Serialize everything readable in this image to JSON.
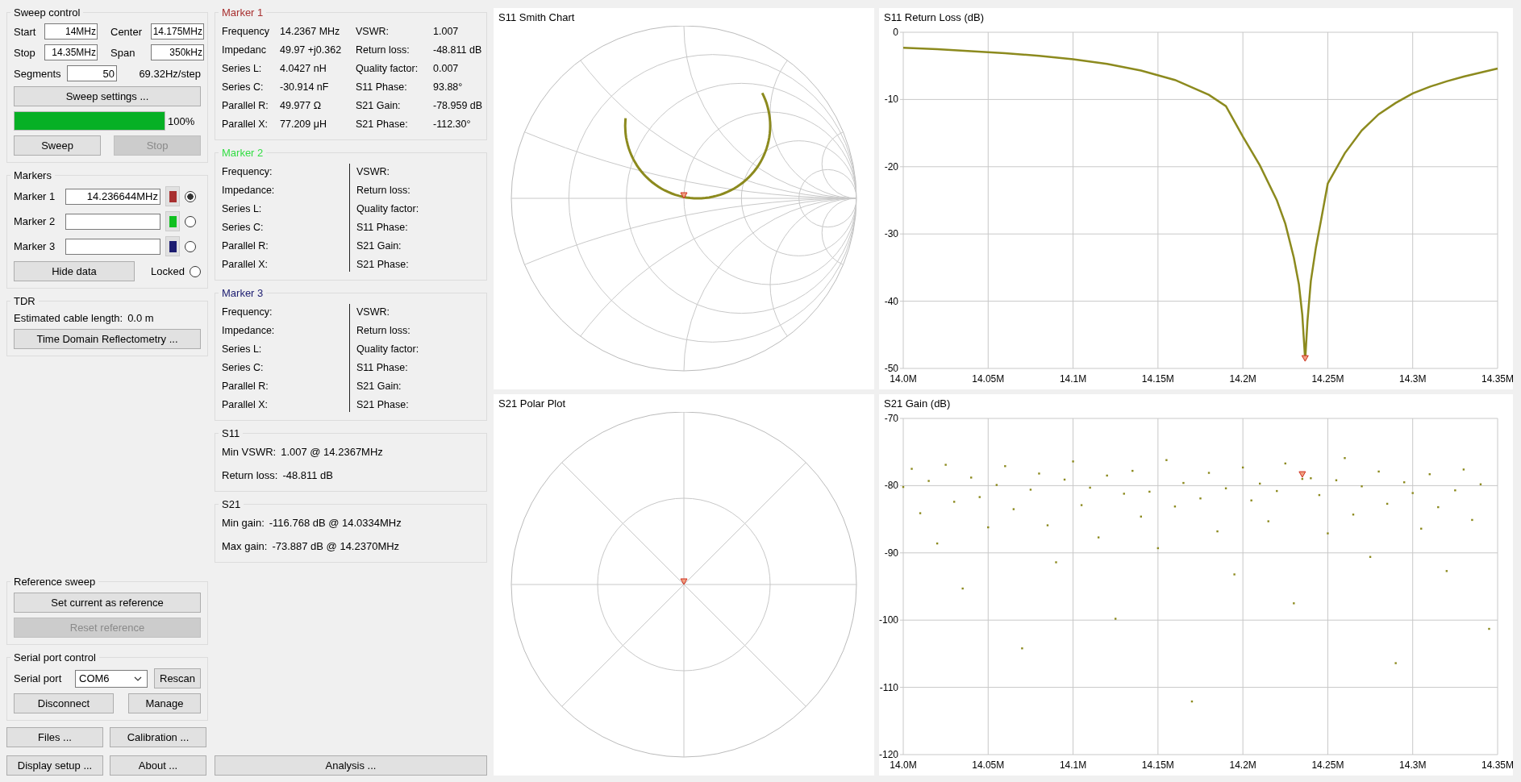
{
  "sweep_control": {
    "title": "Sweep control",
    "fields": [
      {
        "label": "Start",
        "value": "14MHz"
      },
      {
        "label": "Stop",
        "value": "14.35MHz"
      },
      {
        "label": "Center",
        "value": "14.175MHz"
      },
      {
        "label": "Span",
        "value": "350kHz"
      }
    ],
    "segments": {
      "label": "Segments",
      "value": "50"
    },
    "step": "69.32Hz/step",
    "settings_button": "Sweep settings ...",
    "progress": {
      "level": 1,
      "reading": "100%"
    },
    "buttons": [
      {
        "label": "Sweep",
        "disabled": false
      },
      {
        "label": "Stop",
        "disabled": true
      }
    ]
  },
  "markers": {
    "title": "Markers",
    "items": [
      {
        "label": "Marker 1",
        "value": "14.236644MHz",
        "color": "#a83030",
        "selected": true
      },
      {
        "label": "Marker 2",
        "color": "#10c020",
        "selected": false
      },
      {
        "label": "Marker 3",
        "color": "#1c1c70",
        "selected": false
      }
    ],
    "hide_button": "Hide data",
    "locked": {
      "label": "Locked",
      "checked": false
    }
  },
  "tdr": {
    "title": "TDR",
    "length_label": "Estimated cable length:",
    "length": "0.0 m",
    "button": "Time Domain Reflectometry ..."
  },
  "reference_sweep": {
    "title": "Reference sweep",
    "buttons": [
      {
        "label": "Set current as reference",
        "disabled": false
      },
      {
        "label": "Reset reference",
        "disabled": true
      }
    ]
  },
  "serial_port": {
    "title": "Serial port control",
    "label": "Serial port",
    "port": "COM6",
    "rescan": "Rescan",
    "buttons": [
      "Disconnect",
      "Manage"
    ]
  },
  "bottom_buttons": [
    "Files ...",
    "Calibration ...",
    "Display setup ...",
    "About ..."
  ],
  "analysis_button": "Analysis ...",
  "marker_panels": [
    {
      "title": "Marker 1",
      "color": "#a83030",
      "left": [
        {
          "label": "Frequency",
          "value": "14.2367 MHz"
        },
        {
          "label": "Impedanc",
          "value": "49.97 +j0.362"
        },
        {
          "label": "Series L:",
          "value": "4.0427 nH"
        },
        {
          "label": "Series C:",
          "value": "-30.914 nF"
        },
        {
          "label": "Parallel R:",
          "value": "49.977 Ω"
        },
        {
          "label": "Parallel X:",
          "value": "77.209 μH"
        }
      ],
      "right": [
        {
          "label": "VSWR:",
          "value": "1.007"
        },
        {
          "label": "Return loss:",
          "value": "-48.811 dB"
        },
        {
          "label": "Quality factor:",
          "value": "0.007"
        },
        {
          "label": "S11 Phase:",
          "value": "93.88°"
        },
        {
          "label": "S21 Gain:",
          "value": "-78.959 dB"
        },
        {
          "label": "S21 Phase:",
          "value": "-112.30°"
        }
      ]
    },
    {
      "title": "Marker 2",
      "color": "#33dd44",
      "left": [
        {
          "label": "Frequency:"
        },
        {
          "label": "Impedance:"
        },
        {
          "label": "Series L:"
        },
        {
          "label": "Series C:"
        },
        {
          "label": "Parallel R:"
        },
        {
          "label": "Parallel X:"
        }
      ],
      "right": [
        {
          "label": "VSWR:"
        },
        {
          "label": "Return loss:"
        },
        {
          "label": "Quality factor:"
        },
        {
          "label": "S11 Phase:"
        },
        {
          "label": "S21 Gain:"
        },
        {
          "label": "S21 Phase:"
        }
      ]
    },
    {
      "title": "Marker 3",
      "color": "#1c1c70",
      "left": [
        {
          "label": "Frequency:"
        },
        {
          "label": "Impedance:"
        },
        {
          "label": "Series L:"
        },
        {
          "label": "Series C:"
        },
        {
          "label": "Parallel R:"
        },
        {
          "label": "Parallel X:"
        }
      ],
      "right": [
        {
          "label": "VSWR:"
        },
        {
          "label": "Return loss:"
        },
        {
          "label": "Quality factor:"
        },
        {
          "label": "S11 Phase:"
        },
        {
          "label": "S21 Gain:"
        },
        {
          "label": "S21 Phase:"
        }
      ]
    }
  ],
  "summaries": [
    {
      "title": "S11",
      "rows": [
        {
          "label": "Min VSWR:",
          "value": "1.007 @ 14.2367MHz"
        },
        {
          "label": "Return loss:",
          "value": "-48.811 dB"
        }
      ]
    },
    {
      "title": "S21",
      "rows": [
        {
          "label": "Min gain:",
          "value": "-116.768 dB @ 14.0334MHz"
        },
        {
          "label": "Max gain:",
          "value": "-73.887 dB @ 14.2370MHz"
        }
      ]
    }
  ],
  "charts": [
    {
      "title": "S11 Smith Chart",
      "kind": "smith"
    },
    {
      "title": "S11 Return Loss (dB)",
      "kind": "plot",
      "chart_data": {
        "type": "line",
        "x": [
          14.0,
          14.02,
          14.04,
          14.06,
          14.08,
          14.1,
          14.12,
          14.14,
          14.16,
          14.18,
          14.19,
          14.2,
          14.21,
          14.22,
          14.225,
          14.23,
          14.233,
          14.235,
          14.2367,
          14.238,
          14.24,
          14.243,
          14.246,
          14.25,
          14.26,
          14.27,
          14.28,
          14.29,
          14.3,
          14.31,
          14.32,
          14.33,
          14.34,
          14.35
        ],
        "series": [
          {
            "color": "#8c8a1e",
            "values": [
              -2.3,
              -2.5,
              -2.8,
              -3.1,
              -3.5,
              -4.0,
              -4.7,
              -5.7,
              -7.1,
              -9.3,
              -11.0,
              -15.5,
              -19.8,
              -25.0,
              -28.5,
              -33.5,
              -37.5,
              -42.0,
              -48.8,
              -43.0,
              -37.0,
              -32.0,
              -28.0,
              -22.5,
              -18.0,
              -14.6,
              -12.2,
              -10.5,
              -9.1,
              -8.1,
              -7.3,
              -6.6,
              -6.0,
              -5.4
            ]
          }
        ],
        "xlim": [
          14.0,
          14.35
        ],
        "ylim": [
          -50,
          0
        ],
        "xticks": [
          {
            "value": 14.0,
            "label": "14.0M"
          },
          {
            "value": 14.05,
            "label": "14.05M"
          },
          {
            "value": 14.1,
            "label": "14.1M"
          },
          {
            "value": 14.15,
            "label": "14.15M"
          },
          {
            "value": 14.2,
            "label": "14.2M"
          },
          {
            "value": 14.25,
            "label": "14.25M"
          },
          {
            "value": 14.3,
            "label": "14.3M"
          },
          {
            "value": 14.35,
            "label": "14.35M"
          }
        ],
        "yticks": [
          0,
          -10,
          -20,
          -30,
          -40,
          -50
        ],
        "grid": true
      }
    },
    {
      "title": "S21 Polar Plot",
      "kind": "polar"
    },
    {
      "title": "S21 Gain (dB)",
      "kind": "plot",
      "chart_data": {
        "type": "scatter",
        "x": [
          14.0,
          14.005,
          14.01,
          14.015,
          14.02,
          14.025,
          14.03,
          14.035,
          14.04,
          14.045,
          14.05,
          14.055,
          14.06,
          14.065,
          14.07,
          14.075,
          14.08,
          14.085,
          14.09,
          14.095,
          14.1,
          14.105,
          14.11,
          14.115,
          14.12,
          14.125,
          14.13,
          14.135,
          14.14,
          14.145,
          14.15,
          14.155,
          14.16,
          14.165,
          14.17,
          14.175,
          14.18,
          14.185,
          14.19,
          14.195,
          14.2,
          14.205,
          14.21,
          14.215,
          14.22,
          14.225,
          14.23,
          14.235,
          14.24,
          14.245,
          14.25,
          14.255,
          14.26,
          14.265,
          14.27,
          14.275,
          14.28,
          14.285,
          14.29,
          14.295,
          14.3,
          14.305,
          14.31,
          14.315,
          14.32,
          14.325,
          14.33,
          14.335,
          14.34,
          14.345
        ],
        "series": [
          {
            "color": "#8c8a1e",
            "values": [
              -80.2,
              -77.5,
              -84.1,
              -79.3,
              -88.6,
              -76.9,
              -82.4,
              -95.3,
              -78.8,
              -81.7,
              -86.2,
              -79.9,
              -77.1,
              -83.5,
              -104.2,
              -80.6,
              -78.2,
              -85.9,
              -91.4,
              -79.1,
              -76.4,
              -82.9,
              -80.3,
              -87.7,
              -78.5,
              -99.8,
              -81.2,
              -77.8,
              -84.6,
              -80.9,
              -89.3,
              -76.2,
              -83.1,
              -79.6,
              -112.1,
              -81.9,
              -78.1,
              -86.8,
              -80.4,
              -93.2,
              -77.3,
              -82.2,
              -79.7,
              -85.3,
              -80.8,
              -76.7,
              -97.5,
              -79.0,
              -78.9,
              -81.4,
              -87.1,
              -79.2,
              -75.9,
              -84.3,
              -80.1,
              -90.6,
              -77.9,
              -82.7,
              -106.4,
              -79.5,
              -81.1,
              -86.4,
              -78.3,
              -83.2,
              -92.7,
              -80.7,
              -77.6,
              -85.1,
              -79.8,
              -101.3
            ]
          }
        ],
        "xlim": [
          14.0,
          14.35
        ],
        "ylim": [
          -120,
          -70
        ],
        "xticks": [
          {
            "value": 14.0,
            "label": "14.0M"
          },
          {
            "value": 14.05,
            "label": "14.05M"
          },
          {
            "value": 14.1,
            "label": "14.1M"
          },
          {
            "value": 14.15,
            "label": "14.15M"
          },
          {
            "value": 14.2,
            "label": "14.2M"
          },
          {
            "value": 14.25,
            "label": "14.25M"
          },
          {
            "value": 14.3,
            "label": "14.3M"
          },
          {
            "value": 14.35,
            "label": "14.35M"
          }
        ],
        "yticks": [
          -70,
          -80,
          -90,
          -100,
          -110,
          -120
        ],
        "grid": true
      }
    }
  ]
}
